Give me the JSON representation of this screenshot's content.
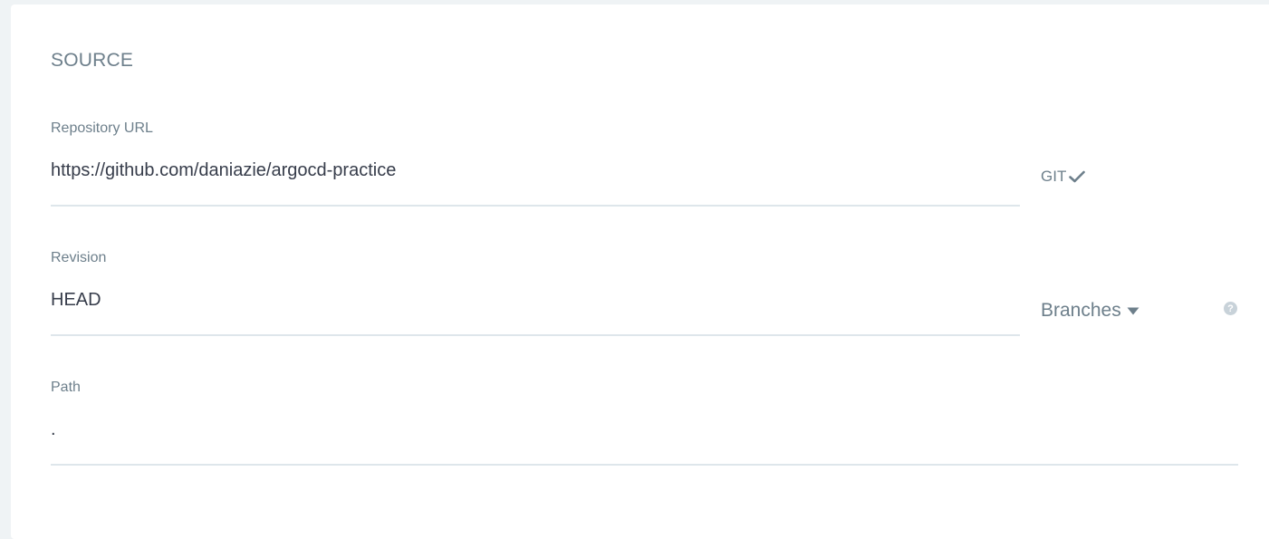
{
  "section": {
    "title": "SOURCE"
  },
  "repo_url": {
    "label": "Repository URL",
    "value": "https://github.com/daniazie/argocd-practice",
    "type_label": "GIT",
    "type_icon": "check-icon"
  },
  "revision": {
    "label": "Revision",
    "value": "HEAD",
    "selector_label": "Branches",
    "selector_icon": "caret-down-icon",
    "help_icon": "question-icon",
    "help_glyph": "?"
  },
  "path": {
    "label": "Path",
    "value": "."
  },
  "colors": {
    "label": "#6d7f8b",
    "value": "#363c4a",
    "underline": "#dee6eb",
    "background": "#eff3f5",
    "panel": "#ffffff"
  }
}
